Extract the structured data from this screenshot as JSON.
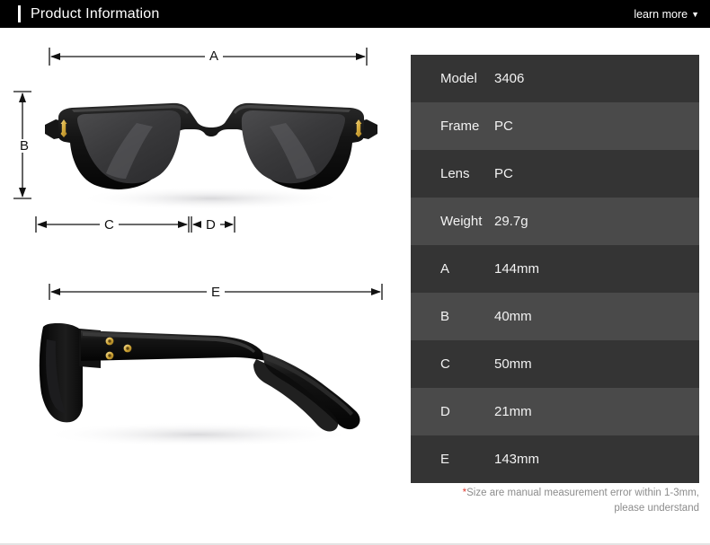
{
  "header": {
    "title": "Product Information",
    "learn_more_label": "learn more",
    "caret_glyph": "▼",
    "background_color": "#000000",
    "text_color": "#ffffff"
  },
  "diagram": {
    "front_view_alt": "black-square-frame-sunglasses-front-view",
    "side_view_alt": "black-square-frame-sunglasses-side-view",
    "dimension_markers": [
      {
        "id": "A",
        "label": "A",
        "orientation": "horizontal",
        "view": "front",
        "measures": "total-frame-width"
      },
      {
        "id": "B",
        "label": "B",
        "orientation": "vertical",
        "view": "front",
        "measures": "lens-height"
      },
      {
        "id": "C",
        "label": "C",
        "orientation": "horizontal",
        "view": "front",
        "measures": "lens-width"
      },
      {
        "id": "D",
        "label": "D",
        "orientation": "horizontal",
        "view": "front",
        "measures": "bridge-width"
      },
      {
        "id": "E",
        "label": "E",
        "orientation": "horizontal",
        "view": "side",
        "measures": "temple-length"
      }
    ],
    "accent_color": "#d6a93c",
    "frame_color": "#111111",
    "lens_color": "#3a3a3a"
  },
  "specs": {
    "rows": [
      {
        "key": "Model",
        "value": "3406"
      },
      {
        "key": "Frame",
        "value": "PC"
      },
      {
        "key": "Lens",
        "value": "PC"
      },
      {
        "key": "Weight",
        "value": "29.7g"
      },
      {
        "key": "A",
        "value": "144mm"
      },
      {
        "key": "B",
        "value": "40mm"
      },
      {
        "key": "C",
        "value": "50mm"
      },
      {
        "key": "D",
        "value": "21mm"
      },
      {
        "key": "E",
        "value": "143mm"
      }
    ],
    "row_color_odd": "#343434",
    "row_color_even": "#4a4a4a",
    "text_color": "#f2f2f2",
    "note_asterisk": "*",
    "note_line_1": "Size are manual measurement error within 1-3mm,",
    "note_line_2": "please understand",
    "note_color": "#8c8c8c",
    "asterisk_color": "#e03c31"
  }
}
